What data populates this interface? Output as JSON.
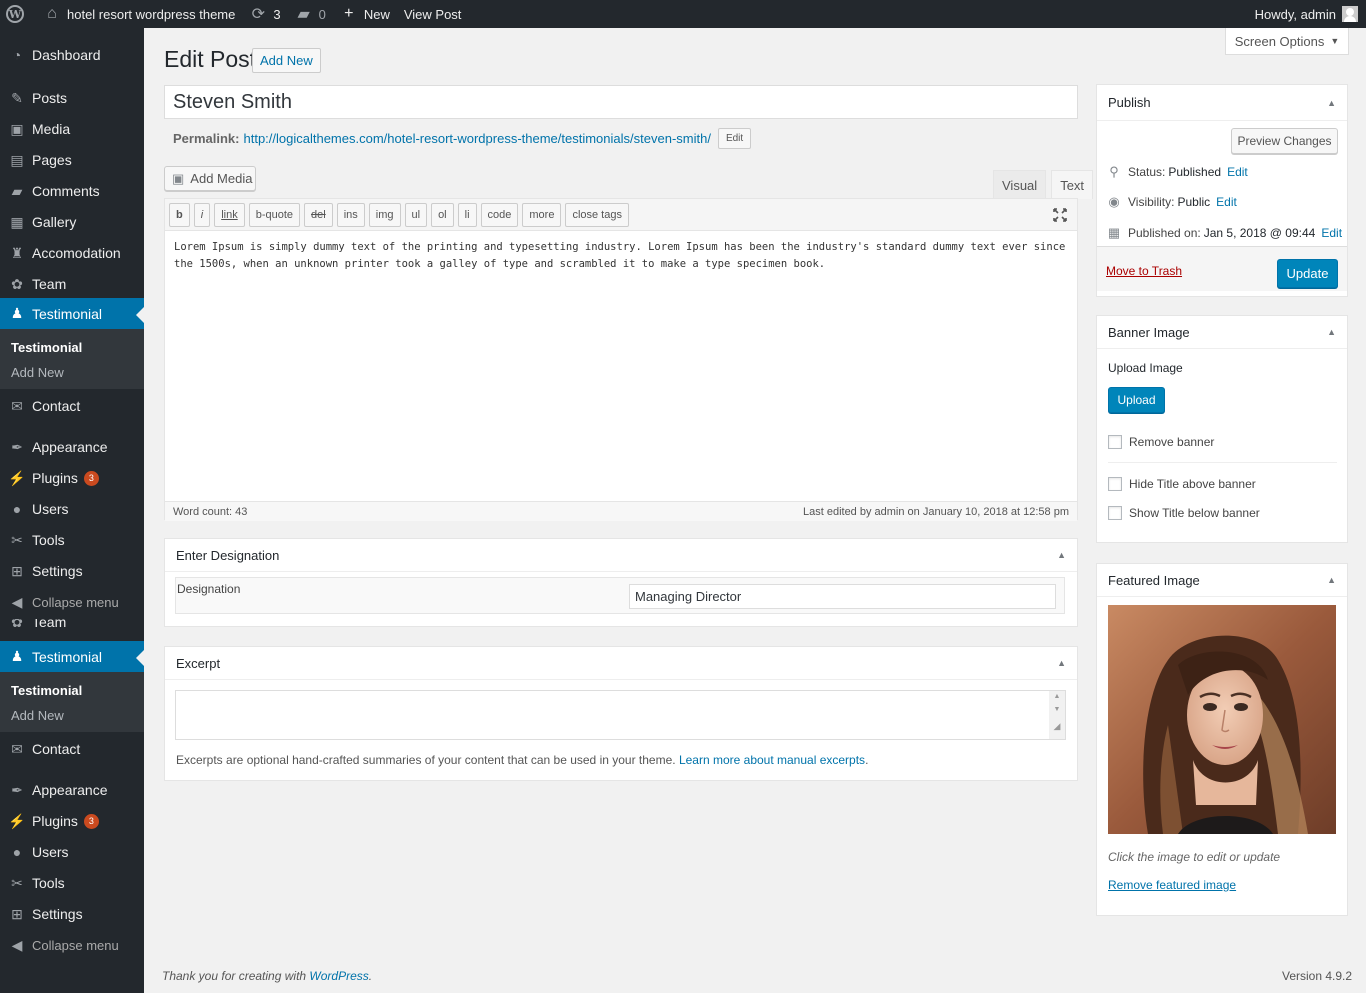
{
  "adminbar": {
    "site_name": "hotel resort wordpress theme",
    "updates_count": "3",
    "comments_count": "0",
    "new_label": "New",
    "view_post_label": "View Post",
    "howdy": "Howdy, admin"
  },
  "menu": {
    "items_top": [
      {
        "label": "Dashboard",
        "icon": "dashboard-icon"
      },
      {
        "label": "Posts",
        "icon": "pin-icon"
      },
      {
        "label": "Media",
        "icon": "media-icon"
      },
      {
        "label": "Pages",
        "icon": "pages-icon"
      },
      {
        "label": "Comments",
        "icon": "comments-icon"
      },
      {
        "label": "Gallery",
        "icon": "gallery-icon"
      },
      {
        "label": "Accomodation",
        "icon": "accomodation-icon"
      },
      {
        "label": "Team",
        "icon": "team-icon"
      },
      {
        "label": "Testimonial",
        "icon": "testimonial-icon"
      }
    ],
    "submenu": [
      "Testimonial",
      "Add New"
    ],
    "items_bottom": [
      {
        "label": "Contact",
        "icon": "mail-icon"
      },
      {
        "label": "Appearance",
        "icon": "appearance-icon"
      },
      {
        "label": "Plugins",
        "icon": "plugins-icon",
        "badge": "3"
      },
      {
        "label": "Users",
        "icon": "users-icon"
      },
      {
        "label": "Tools",
        "icon": "tools-icon"
      },
      {
        "label": "Settings",
        "icon": "settings-icon"
      },
      {
        "label": "Collapse menu",
        "icon": "collapse-icon"
      }
    ],
    "partial_team_label": "Team"
  },
  "screen_options": "Screen Options",
  "page": {
    "title": "Edit Post",
    "add_new": "Add New",
    "post_title": "Steven Smith",
    "permalink_label": "Permalink:",
    "permalink_url": "http://logicalthemes.com/hotel-resort-wordpress-theme/testimonials/steven-smith/",
    "permalink_edit": "Edit"
  },
  "editor": {
    "add_media": "Add Media",
    "tab_visual": "Visual",
    "tab_text": "Text",
    "quicktags": [
      "b",
      "i",
      "link",
      "b-quote",
      "del",
      "ins",
      "img",
      "ul",
      "ol",
      "li",
      "code",
      "more",
      "close tags"
    ],
    "content": "Lorem Ipsum is simply dummy text of the printing and typesetting industry. Lorem Ipsum has been the industry's standard dummy text ever since the 1500s, when an unknown printer took a galley of type and scrambled it to make a type specimen book.",
    "word_count": "Word count: 43",
    "last_edited": "Last edited by admin on January 10, 2018 at 12:58 pm"
  },
  "designation_box": {
    "title": "Enter Designation",
    "label": "Designation",
    "value": "Managing Director"
  },
  "excerpt_box": {
    "title": "Excerpt",
    "help": "Excerpts are optional hand-crafted summaries of your content that can be used in your theme.",
    "help_link": "Learn more about manual excerpts"
  },
  "publish": {
    "title": "Publish",
    "preview": "Preview Changes",
    "status_label": "Status:",
    "status_value": "Published",
    "visibility_label": "Visibility:",
    "visibility_value": "Public",
    "published_label": "Published on:",
    "published_value": "Jan 5, 2018 @ 09:44",
    "edit": "Edit",
    "trash": "Move to Trash",
    "update": "Update"
  },
  "banner": {
    "title": "Banner Image",
    "upload_label": "Upload Image",
    "upload_btn": "Upload",
    "remove_banner": "Remove banner",
    "hide_title": "Hide Title above banner",
    "show_title": "Show Title below banner"
  },
  "featured": {
    "title": "Featured Image",
    "hint": "Click the image to edit or update",
    "remove": "Remove featured image"
  },
  "footer": {
    "thanks": "Thank you for creating with",
    "wp_link": "WordPress",
    "version": "Version 4.9.2"
  },
  "colors": {
    "menu_bg": "#23282d",
    "accent": "#0073aa",
    "primary_button": "#0085ba",
    "badge": "#ca4a1f"
  }
}
